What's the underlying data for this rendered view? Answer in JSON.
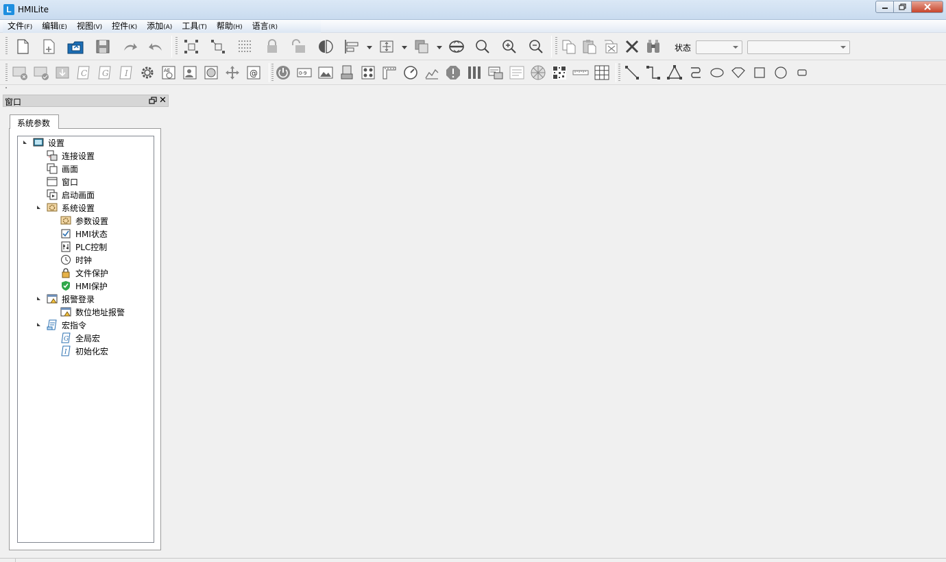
{
  "window": {
    "title": "HMILite"
  },
  "menu": [
    {
      "label": "文件",
      "accel": "(F)"
    },
    {
      "label": "编辑",
      "accel": "(E)"
    },
    {
      "label": "视图",
      "accel": "(V)"
    },
    {
      "label": "控件",
      "accel": "(K)"
    },
    {
      "label": "添加",
      "accel": "(A)"
    },
    {
      "label": "工具",
      "accel": "(T)"
    },
    {
      "label": "帮助",
      "accel": "(H)"
    },
    {
      "label": "语言",
      "accel": "(R)"
    }
  ],
  "toolbar": {
    "status_label": "状态",
    "status_combo_value": "",
    "state_combo_value": ""
  },
  "dock": {
    "title": "窗口",
    "tab_label": "系统参数"
  },
  "tree": {
    "root": "设置",
    "connection": "连接设置",
    "screen": "画面",
    "window": "窗口",
    "startup_screen": "启动画面",
    "system_settings": "系统设置",
    "parameter_settings": "参数设置",
    "hmi_status": "HMI状态",
    "plc_control": "PLC控制",
    "clock": "时钟",
    "file_protection": "文件保护",
    "hmi_protection": "HMI保护",
    "alarm_login": "报警登录",
    "bit_address_alarm": "数位地址报警",
    "macro": "宏指令",
    "global_macro": "全局宏",
    "init_macro": "初始化宏"
  },
  "colors": {
    "accent": "#1e8fe0",
    "titlebar": "#c9dbef",
    "close": "#c8452c"
  }
}
